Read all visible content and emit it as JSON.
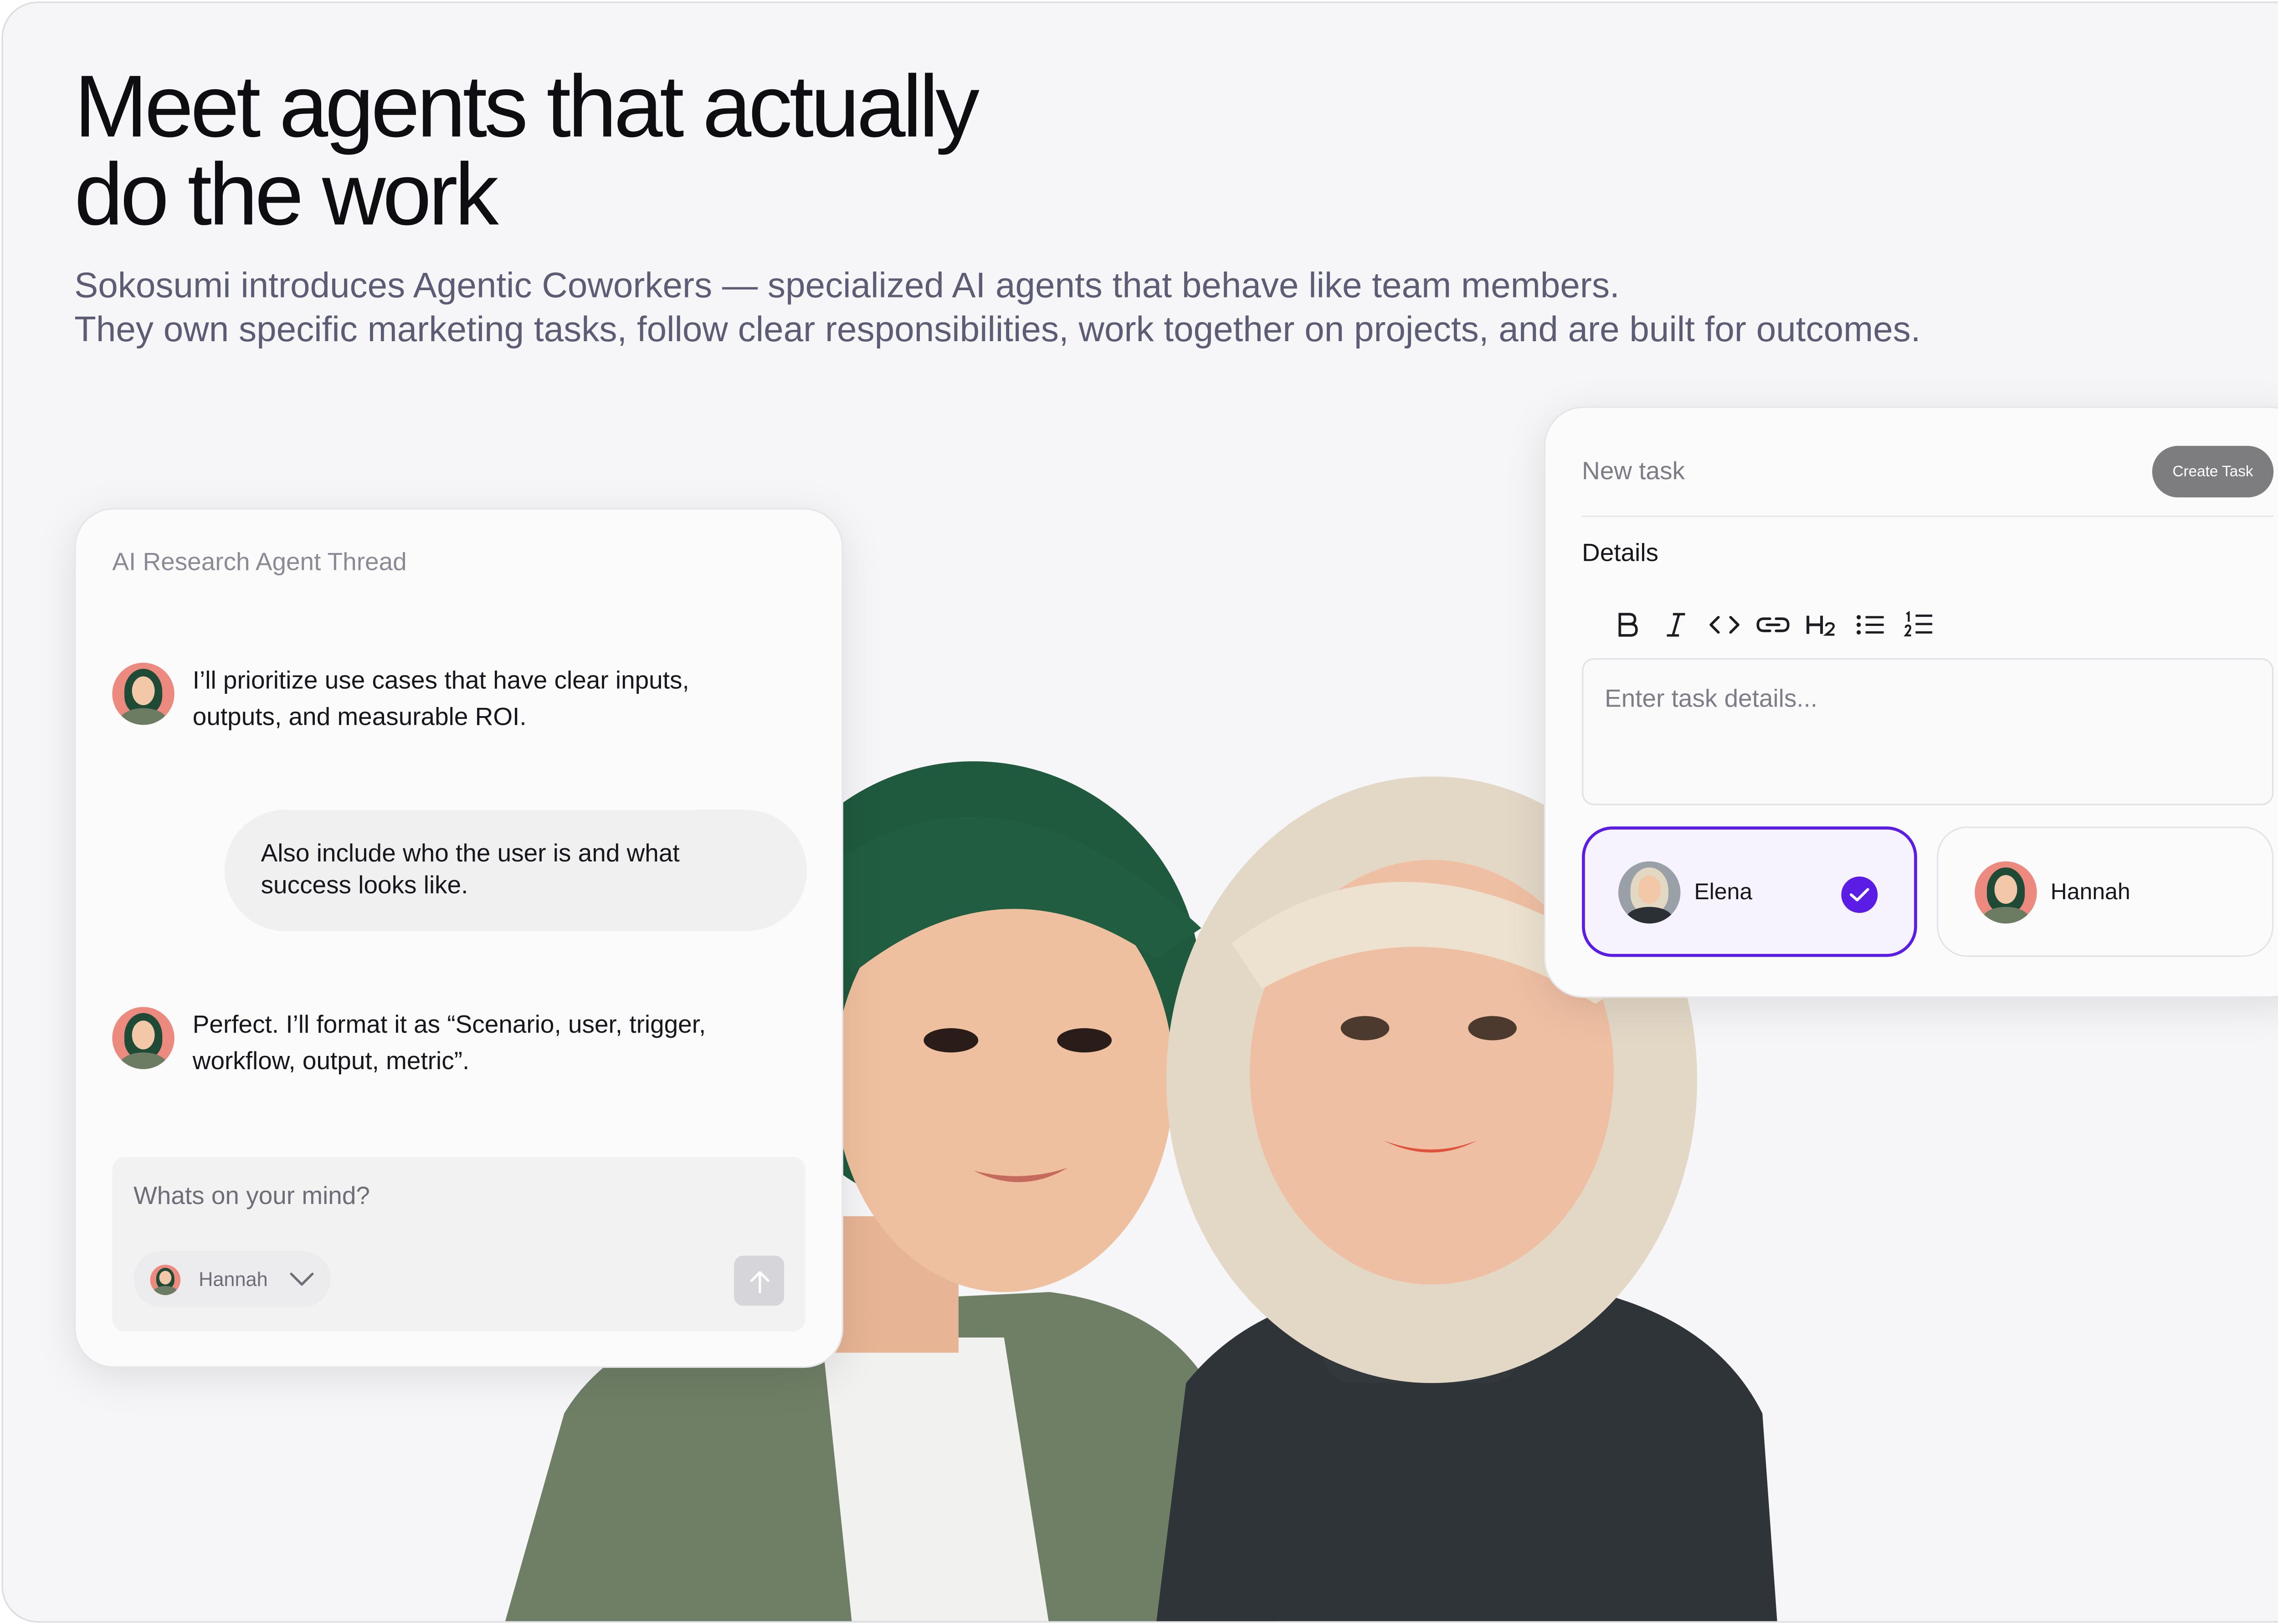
{
  "hero": {
    "title_line1": "Meet agents that actually",
    "title_line2": "do the work",
    "subtitle_line1": "Sokosumi introduces Agentic Coworkers — specialized AI agents that behave like team members.",
    "subtitle_line2": "They own specific marketing tasks, follow clear responsibilities, work together on projects, and are built for outcomes."
  },
  "thread": {
    "title": "AI Research Agent Thread",
    "messages": [
      {
        "role": "agent",
        "agent": "Hannah",
        "text": "I’ll prioritize use cases that have clear inputs, outputs, and measurable ROI."
      },
      {
        "role": "user",
        "text": "Also include who the user is and what success looks like."
      },
      {
        "role": "agent",
        "agent": "Hannah",
        "text": "Perfect. I’ll format it as “Scenario, user, trigger, workflow, output, metric”."
      }
    ],
    "composer": {
      "placeholder": "Whats on your mind?",
      "selected_agent": "Hannah"
    }
  },
  "task_form": {
    "title_placeholder": "New task",
    "create_button": "Create Task",
    "details_label": "Details",
    "toolbar": [
      "bold-icon",
      "italic-icon",
      "code-icon",
      "link-icon",
      "heading-2-icon",
      "bullet-list-icon",
      "numbered-list-icon"
    ],
    "details_placeholder": "Enter task details...",
    "assignees": [
      {
        "name": "Elena",
        "selected": true
      },
      {
        "name": "Hannah",
        "selected": false
      }
    ]
  },
  "colors": {
    "accent": "#5b1ce6",
    "background": "#f6f6f8",
    "headline": "#0d0d12",
    "subtitle": "#5c5c74"
  }
}
